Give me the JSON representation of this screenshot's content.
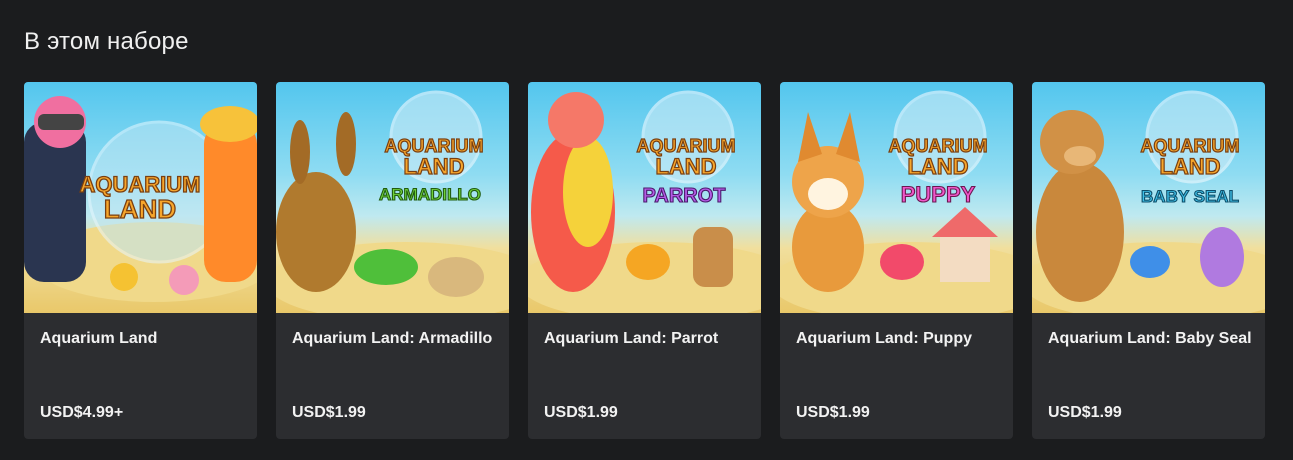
{
  "section": {
    "title": "В этом наборе"
  },
  "items": [
    {
      "title": "Aquarium Land",
      "price": "USD$4.99+",
      "art": {
        "logo_line1": "AQUARIUM",
        "logo_line2": "LAND",
        "subtitle": ""
      }
    },
    {
      "title": "Aquarium Land: Armadillo",
      "price": "USD$1.99",
      "art": {
        "logo_line1": "AQUARIUM",
        "logo_line2": "LAND",
        "subtitle": "ARMADILLO"
      }
    },
    {
      "title": "Aquarium Land: Parrot",
      "price": "USD$1.99",
      "art": {
        "logo_line1": "AQUARIUM",
        "logo_line2": "LAND",
        "subtitle": "PARROT"
      }
    },
    {
      "title": "Aquarium Land: Puppy",
      "price": "USD$1.99",
      "art": {
        "logo_line1": "AQUARIUM",
        "logo_line2": "LAND",
        "subtitle": "PUPPY"
      }
    },
    {
      "title": "Aquarium Land: Baby Seal",
      "price": "USD$1.99",
      "art": {
        "logo_line1": "AQUARIUM",
        "logo_line2": "LAND",
        "subtitle": "BABY SEAL"
      }
    }
  ],
  "colors": {
    "background": "#1b1c1e",
    "card": "#2c2d30",
    "text": "#f2f2f2",
    "logo_orange": "#f5a623",
    "subtitle_colors": [
      "#6fd13a",
      "#b45be6",
      "#ef57c9",
      "#3fc0e8"
    ]
  }
}
